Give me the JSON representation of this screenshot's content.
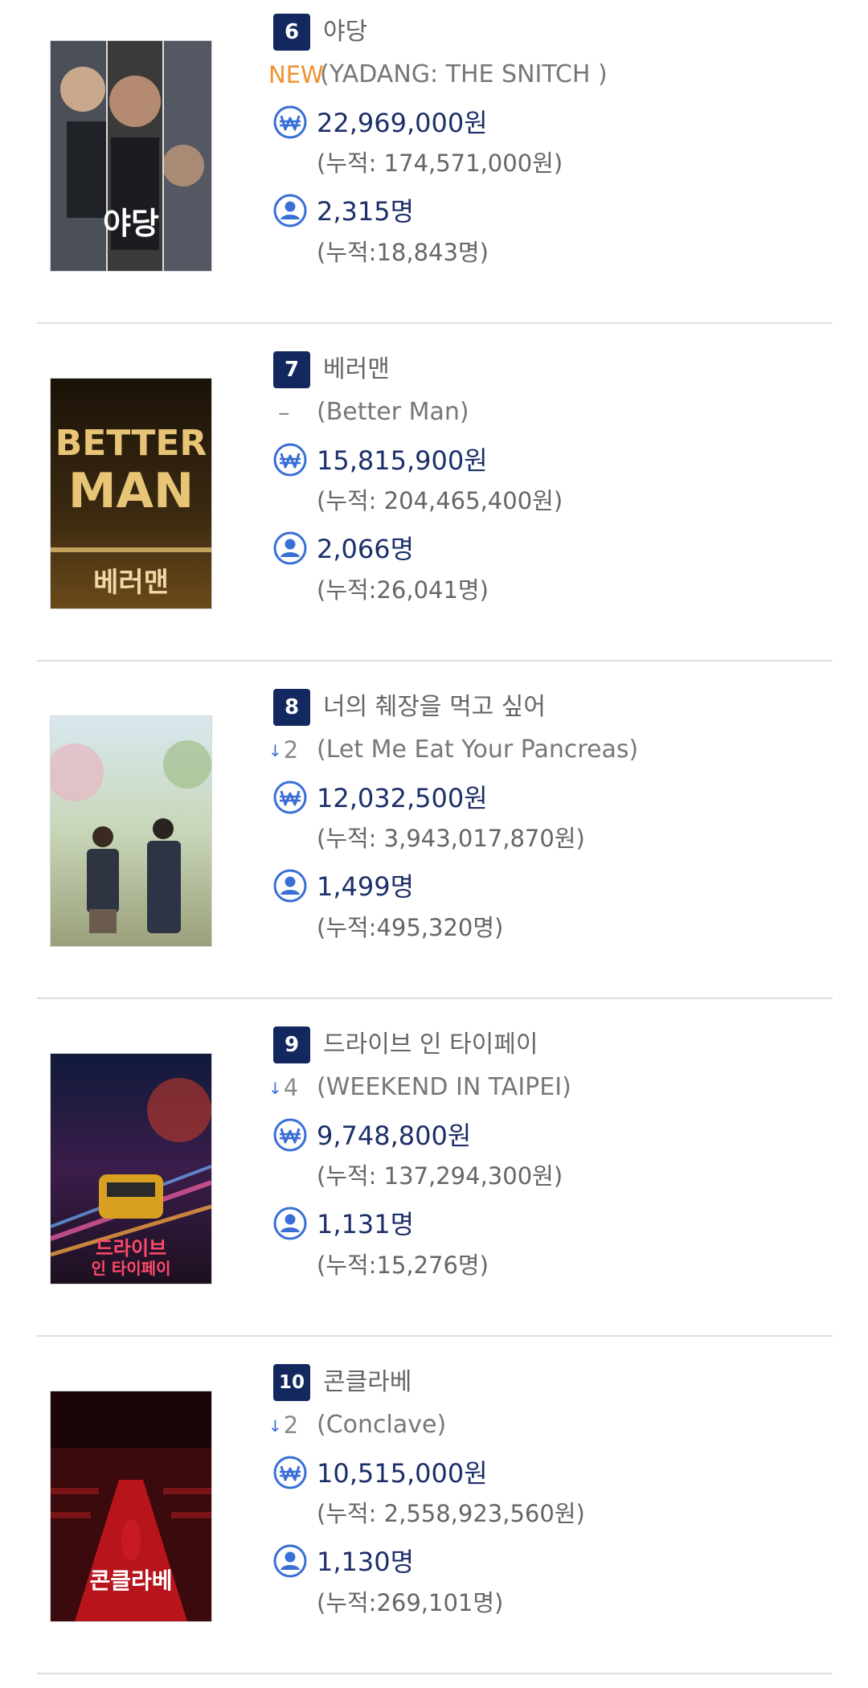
{
  "movies": [
    {
      "rank": "6",
      "title": "야당",
      "change_type": "new",
      "change_text": "NEW",
      "original_title": "(YADANG: THE SNITCH )",
      "sales": "22,969,000원",
      "sales_cumulative": "(누적: 174,571,000원)",
      "audience": "2,315명",
      "audience_cumulative": "(누적:18,843명)",
      "poster_text": "야당"
    },
    {
      "rank": "7",
      "title": "베러맨",
      "change_type": "same",
      "change_text": "–",
      "original_title": "(Better Man)",
      "sales": "15,815,900원",
      "sales_cumulative": "(누적: 204,465,400원)",
      "audience": "2,066명",
      "audience_cumulative": "(누적:26,041명)",
      "poster_text": "BETTER MAN 베러맨"
    },
    {
      "rank": "8",
      "title": "너의 췌장을 먹고 싶어",
      "change_type": "down",
      "change_text": "2",
      "original_title": "(Let Me Eat Your Pancreas)",
      "sales": "12,032,500원",
      "sales_cumulative": "(누적: 3,943,017,870원)",
      "audience": "1,499명",
      "audience_cumulative": "(누적:495,320명)",
      "poster_text": ""
    },
    {
      "rank": "9",
      "title": "드라이브 인 타이페이",
      "change_type": "down",
      "change_text": "4",
      "original_title": "(WEEKEND IN TAIPEI)",
      "sales": "9,748,800원",
      "sales_cumulative": "(누적: 137,294,300원)",
      "audience": "1,131명",
      "audience_cumulative": "(누적:15,276명)",
      "poster_text": "드라이브 인 타이페이"
    },
    {
      "rank": "10",
      "title": "콘클라베",
      "change_type": "down",
      "change_text": "2",
      "original_title": "(Conclave)",
      "sales": "10,515,000원",
      "sales_cumulative": "(누적: 2,558,923,560원)",
      "audience": "1,130명",
      "audience_cumulative": "(누적:269,101명)",
      "poster_text": "콘클라베"
    }
  ],
  "icons": {
    "sales": "won-icon",
    "audience": "person-icon",
    "down": "down-arrow-icon"
  },
  "colors": {
    "rank_bg": "#12285f",
    "accent_blue": "#3a6fd6",
    "new_orange": "#f2912f",
    "amount_text": "#1d2f69"
  }
}
